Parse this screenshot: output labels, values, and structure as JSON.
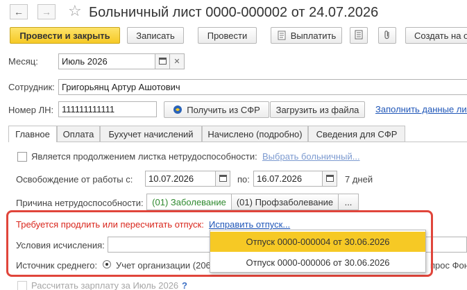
{
  "window": {
    "title": "Больничный лист 0000-000002 от 24.07.2026",
    "back_glyph": "←",
    "forward_glyph": "→",
    "star_glyph": "☆"
  },
  "toolbar": {
    "post_and_close": "Провести и закрыть",
    "save": "Записать",
    "post": "Провести",
    "pay": "Выплатить",
    "create_based_on": "Создать на о"
  },
  "form": {
    "month_label": "Месяц:",
    "month_value": "Июль 2026",
    "employee_label": "Сотрудник:",
    "employee_value": "Григорьянц Артур Ашотович",
    "ln_label": "Номер ЛН:",
    "ln_value": "111111111111",
    "get_from_sfr": "Получить из СФР",
    "load_from_file": "Загрузить из файла",
    "fill_data_link": "Заполнить данные лис"
  },
  "tabs": [
    {
      "label": "Главное",
      "active": true
    },
    {
      "label": "Оплата",
      "active": false
    },
    {
      "label": "Бухучет начислений",
      "active": false
    },
    {
      "label": "Начислено (подробно)",
      "active": false
    },
    {
      "label": "Сведения для СФР",
      "active": false
    }
  ],
  "main": {
    "continuation_label": "Является продолжением листка нетрудоспособности:",
    "choose_sick_link": "Выбрать больничный...",
    "release_label": "Освобождение от работы с:",
    "date_from": "10.07.2026",
    "to_label": "по:",
    "date_to": "16.07.2026",
    "days": "7 дней",
    "reason_label": "Причина нетрудоспособности:",
    "reason_disease": "(01) Заболевание",
    "reason_occupational": "(01) Профзаболевание",
    "reason_more": "...",
    "warning_text": "Требуется продлить или пересчитать отпуск:",
    "fix_vacation_link": "Исправить отпуск...",
    "calc_conditions_label": "Условия исчисления:",
    "avg_source_label": "Источник среднего:",
    "avg_source_option": "Учет организации (206",
    "request_fragment": "прос Фон",
    "recalc_salary": "Рассчитать зарплату за Июль 2026",
    "help_mark": "?"
  },
  "dropdown": {
    "items": [
      {
        "label": "Отпуск 0000-000004 от 30.06.2026",
        "selected": true
      },
      {
        "label": "Отпуск 0000-000006 от 30.06.2026",
        "selected": false
      }
    ]
  },
  "colors": {
    "accent_yellow": "#f6c925",
    "warning_red": "#d9261c",
    "link_blue": "#1f56b8",
    "selected_green": "#2f8a2f",
    "highlight_border": "#e0453b"
  }
}
